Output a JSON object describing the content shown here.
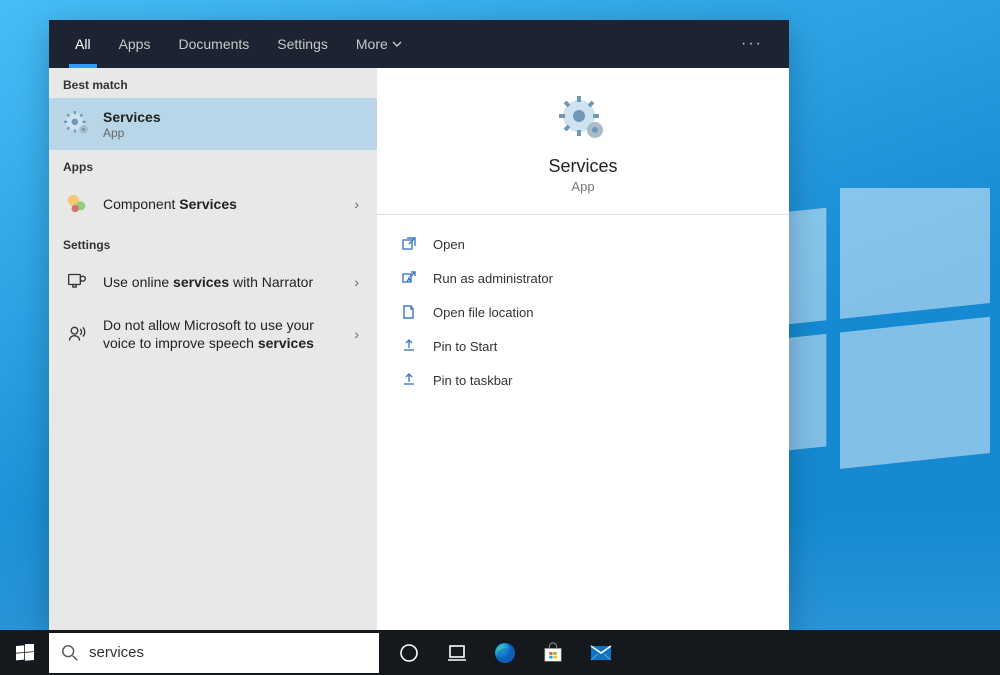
{
  "tabs": {
    "all": "All",
    "apps": "Apps",
    "documents": "Documents",
    "settings": "Settings",
    "more": "More"
  },
  "left": {
    "best_match": "Best match",
    "best_match_item": {
      "title": "Services",
      "sub": "App"
    },
    "apps_header": "Apps",
    "apps_item": {
      "prefix": "Component ",
      "bold": "Services"
    },
    "settings_header": "Settings",
    "settings_item_1": {
      "prefix": "Use online ",
      "bold": "services",
      "suffix": " with Narrator"
    },
    "settings_item_2": {
      "prefix": "Do not allow Microsoft to use your voice to improve speech ",
      "bold": "services"
    }
  },
  "preview": {
    "title": "Services",
    "sub": "App",
    "actions": {
      "open": "Open",
      "runas": "Run as administrator",
      "openloc": "Open file location",
      "pinstart": "Pin to Start",
      "pintask": "Pin to taskbar"
    }
  },
  "search": {
    "value": "services"
  }
}
